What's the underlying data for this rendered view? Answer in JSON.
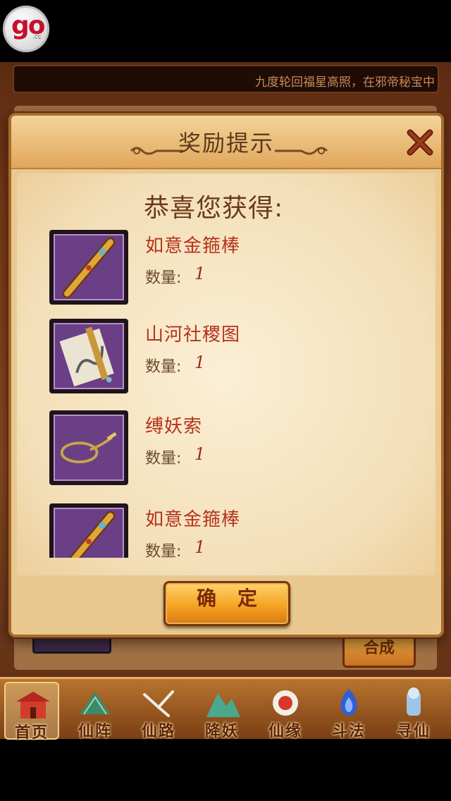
{
  "marquee": {
    "text": "九度轮回福星高照，在邪帝秘宝中"
  },
  "dialog": {
    "title": "奖励提示",
    "congrats": "恭喜您获得:",
    "items": [
      {
        "name": "如意金箍棒",
        "qty_label": "数量:",
        "qty": "1",
        "icon": "golden-staff-icon"
      },
      {
        "name": "山河社稷图",
        "qty_label": "数量:",
        "qty": "1",
        "icon": "scroll-painting-icon"
      },
      {
        "name": "缚妖索",
        "qty_label": "数量:",
        "qty": "1",
        "icon": "binding-rope-icon"
      },
      {
        "name": "如意金箍棒",
        "qty_label": "数量:",
        "qty": "1",
        "icon": "golden-staff-icon"
      }
    ],
    "confirm_label": "确定"
  },
  "background": {
    "hecheng_label": "合成"
  },
  "bottom_nav": [
    {
      "label": "首页",
      "icon": "palace-icon",
      "active": true
    },
    {
      "label": "仙阵",
      "icon": "fan-icon"
    },
    {
      "label": "仙路",
      "icon": "crane-icon"
    },
    {
      "label": "降妖",
      "icon": "mountain-icon"
    },
    {
      "label": "仙缘",
      "icon": "sun-crane-icon"
    },
    {
      "label": "斗法",
      "icon": "blue-flame-icon"
    },
    {
      "label": "寻仙",
      "icon": "immortal-icon"
    }
  ],
  "colors": {
    "item_name": "#b5331e",
    "accent": "#f5a423",
    "item_frame": "#6b3f86"
  }
}
